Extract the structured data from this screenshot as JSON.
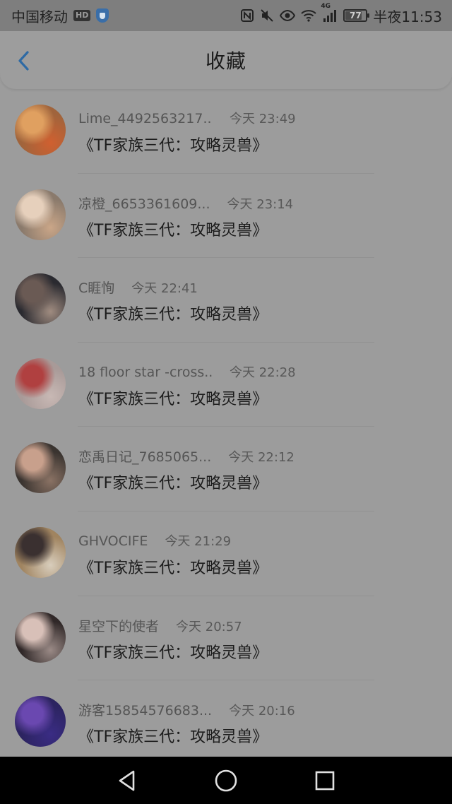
{
  "status_bar": {
    "carrier": "中国移动",
    "hd_badge": "HD",
    "network": "4G",
    "battery": "77",
    "battery_level": 0.77,
    "time": "半夜11:53"
  },
  "header": {
    "title": "收藏",
    "back_icon": "chevron-left-icon"
  },
  "items": [
    {
      "user": "Lime_4492563217...",
      "time": "今天 23:49",
      "title": "《TF家族三代：攻略灵兽》",
      "avatar_colors": [
        "#a0643c",
        "#e0a060",
        "#d06030"
      ]
    },
    {
      "user": "凉橙_6653361609...",
      "time": "今天 23:14",
      "title": "《TF家族三代：攻略灵兽》",
      "avatar_colors": [
        "#8a7a6c",
        "#e6d0bc",
        "#caa688"
      ]
    },
    {
      "user": "C睚恂",
      "time": "今天 22:41",
      "title": "《TF家族三代：攻略灵兽》",
      "avatar_colors": [
        "#2a2a30",
        "#6a5a54",
        "#a08c80"
      ]
    },
    {
      "user": "18 floor star -cross...",
      "time": "今天 22:28",
      "title": "《TF家族三代：攻略灵兽》",
      "avatar_colors": [
        "#a89a98",
        "#b04040",
        "#c8b8b4"
      ]
    },
    {
      "user": "恋禹日记_7685065...",
      "time": "今天 22:12",
      "title": "《TF家族三代：攻略灵兽》",
      "avatar_colors": [
        "#3a3430",
        "#c8a08c",
        "#8a7264"
      ]
    },
    {
      "user": "GHVOCIFE",
      "time": "今天 21:29",
      "title": "《TF家族三代：攻略灵兽》",
      "avatar_colors": [
        "#a08460",
        "#3a3030",
        "#d8cdbc"
      ]
    },
    {
      "user": "星空下的使者",
      "time": "今天 20:57",
      "title": "《TF家族三代：攻略灵兽》",
      "avatar_colors": [
        "#302828",
        "#d8c0b8",
        "#9a8a86"
      ]
    },
    {
      "user": "游客15854576683...",
      "time": "今天 20:16",
      "title": "《TF家族三代：攻略灵兽》",
      "avatar_colors": [
        "#2c2460",
        "#6a48b0",
        "#3a2c84"
      ]
    }
  ],
  "nav": {
    "back_icon": "triangle-back-icon",
    "home_icon": "circle-home-icon",
    "recents_icon": "square-recents-icon"
  }
}
